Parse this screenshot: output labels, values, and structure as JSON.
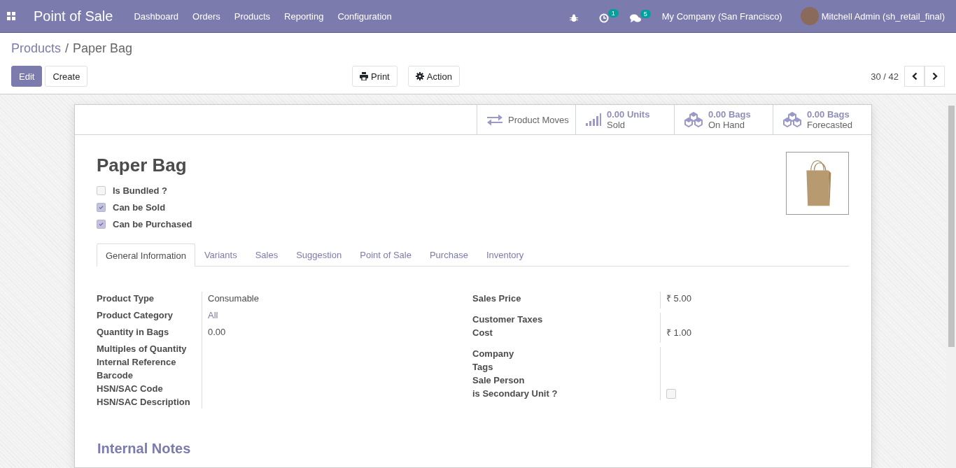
{
  "navbar": {
    "app_title": "Point of Sale",
    "menu": [
      "Dashboard",
      "Orders",
      "Products",
      "Reporting",
      "Configuration"
    ],
    "activity_badge": "1",
    "message_badge": "5",
    "company": "My Company (San Francisco)",
    "user": "Mitchell Admin (sh_retail_final)"
  },
  "breadcrumb": {
    "parent": "Products",
    "separator": "/",
    "current": "Paper Bag"
  },
  "buttons": {
    "edit": "Edit",
    "create": "Create",
    "print": "Print",
    "action": "Action"
  },
  "pager": {
    "value": "30 / 42"
  },
  "stat_buttons": [
    {
      "kind": "moves",
      "label": "Product Moves"
    },
    {
      "kind": "sold",
      "value": "0.00 Units",
      "label": "Sold"
    },
    {
      "kind": "stock",
      "value": "0.00 Bags",
      "label": "On Hand"
    },
    {
      "kind": "stock",
      "value": "0.00 Bags",
      "label": "Forecasted"
    }
  ],
  "product": {
    "name": "Paper Bag",
    "options": [
      {
        "label": "Is Bundled ?",
        "checked": false
      },
      {
        "label": "Can be Sold",
        "checked": true
      },
      {
        "label": "Can be Purchased",
        "checked": true
      }
    ]
  },
  "tabs": [
    {
      "label": "General Information",
      "selected": true
    },
    {
      "label": "Variants",
      "selected": false
    },
    {
      "label": "Sales",
      "selected": false
    },
    {
      "label": "Suggestion",
      "selected": false
    },
    {
      "label": "Point of Sale",
      "selected": false
    },
    {
      "label": "Purchase",
      "selected": false
    },
    {
      "label": "Inventory",
      "selected": false
    }
  ],
  "left_groups": [
    [
      {
        "label": "Product Type",
        "kind": "text",
        "value": "Consumable"
      },
      {
        "label": "Product Category",
        "kind": "link",
        "value": "All"
      },
      {
        "label": "Quantity in Bags",
        "kind": "text",
        "value": "0.00"
      },
      {
        "label": "Multiples of Quantity",
        "kind": "empty"
      },
      {
        "label": "Internal Reference",
        "kind": "empty"
      },
      {
        "label": "Barcode",
        "kind": "empty"
      },
      {
        "label": "HSN/SAC Code",
        "kind": "empty"
      },
      {
        "label": "HSN/SAC Description",
        "kind": "empty"
      }
    ]
  ],
  "right_groups": [
    [
      {
        "label": "Sales Price",
        "kind": "text",
        "value": "₹ 5.00"
      }
    ],
    [
      {
        "label": "Customer Taxes",
        "kind": "empty"
      },
      {
        "label": "Cost",
        "kind": "text",
        "value": "₹ 1.00"
      }
    ],
    [
      {
        "label": "Company",
        "kind": "empty"
      },
      {
        "label": "Tags",
        "kind": "empty"
      },
      {
        "label": "Sale Person",
        "kind": "empty"
      },
      {
        "label": "is Secondary Unit ?",
        "kind": "checkbox",
        "checked": false
      }
    ]
  ],
  "notes_title": "Internal Notes"
}
